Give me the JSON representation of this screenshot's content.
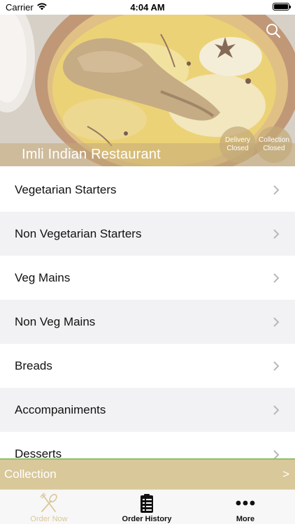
{
  "status_bar": {
    "carrier": "Carrier",
    "time": "4:04 AM"
  },
  "hero": {
    "restaurant_name": "Imli Indian Restaurant",
    "delivery_status": [
      "Delivery",
      "Closed"
    ],
    "collection_status": [
      "Collection",
      "Closed"
    ]
  },
  "menu": {
    "categories": [
      "Vegetarian Starters",
      "Non Vegetarian Starters",
      "Veg Mains",
      "Non Veg Mains",
      "Breads",
      "Accompaniments",
      "Desserts"
    ]
  },
  "collection_bar": {
    "label": "Collection",
    "arrow": ">"
  },
  "tab_bar": {
    "tabs": [
      "Order Now",
      "Order History",
      "More"
    ]
  },
  "colors": {
    "accent": "#d9c89a",
    "accent_border": "#8fc06a",
    "row_alt": "#f2f2f4",
    "chevron": "#b8b8b8"
  }
}
